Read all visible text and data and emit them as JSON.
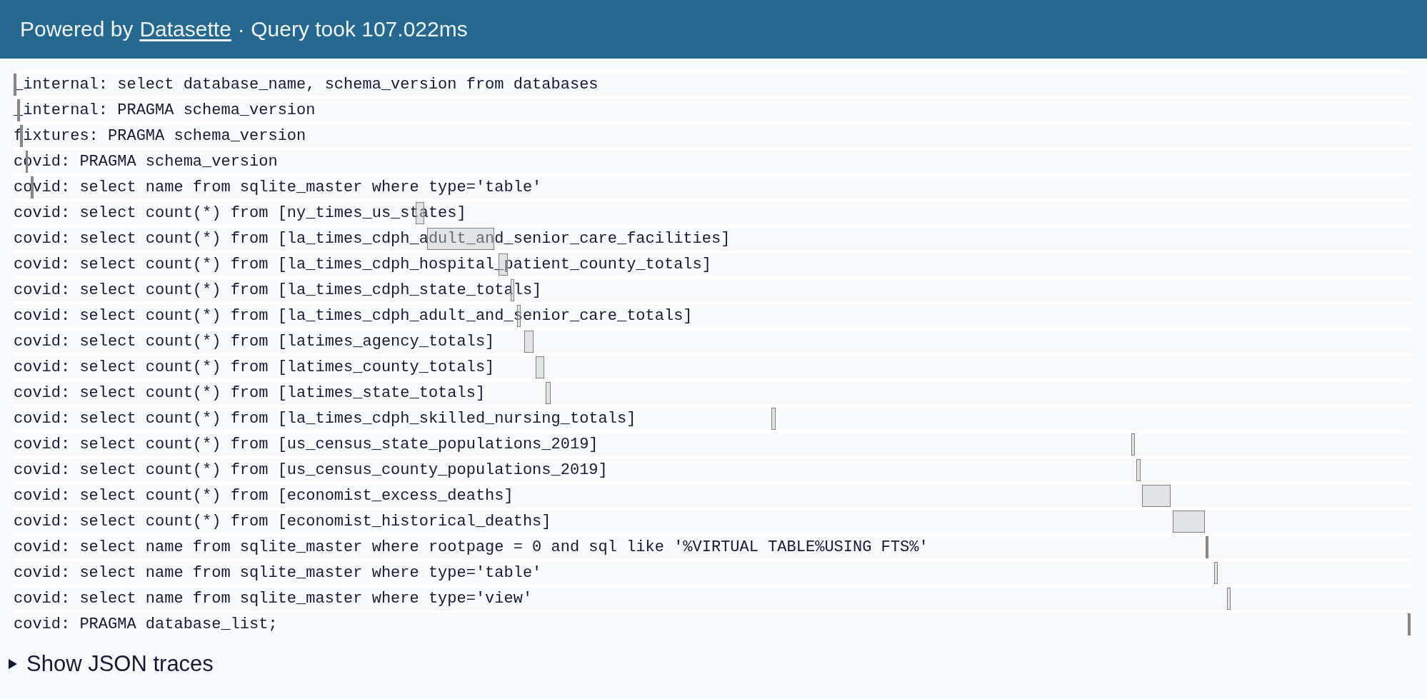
{
  "header": {
    "prefix": "Powered by",
    "link": "Datasette",
    "suffix": "· Query took 107.022ms"
  },
  "traces": [
    "_internal: select database_name, schema_version from databases",
    "_internal: PRAGMA schema_version",
    "fixtures: PRAGMA schema_version",
    "covid: PRAGMA schema_version",
    "covid: select name from sqlite_master where type='table'",
    "covid: select count(*) from [ny_times_us_states]",
    "covid: select count(*) from [la_times_cdph_adult_and_senior_care_facilities]",
    "covid: select count(*) from [la_times_cdph_hospital_patient_county_totals]",
    "covid: select count(*) from [la_times_cdph_state_totals]",
    "covid: select count(*) from [la_times_cdph_adult_and_senior_care_totals]",
    "covid: select count(*) from [latimes_agency_totals]",
    "covid: select count(*) from [latimes_county_totals]",
    "covid: select count(*) from [latimes_state_totals]",
    "covid: select count(*) from [la_times_cdph_skilled_nursing_totals]",
    "covid: select count(*) from [us_census_state_populations_2019]",
    "covid: select count(*) from [us_census_county_populations_2019]",
    "covid: select count(*) from [economist_excess_deaths]",
    "covid: select count(*) from [economist_historical_deaths]",
    "covid: select name from sqlite_master where rootpage = 0 and sql like '%VIRTUAL TABLE%USING FTS%'",
    "covid: select name from sqlite_master where type='table'",
    "covid: select name from sqlite_master where type='view'",
    "covid: PRAGMA database_list;"
  ],
  "json_traces": {
    "summary": "Show JSON traces",
    "expanded": false
  }
}
